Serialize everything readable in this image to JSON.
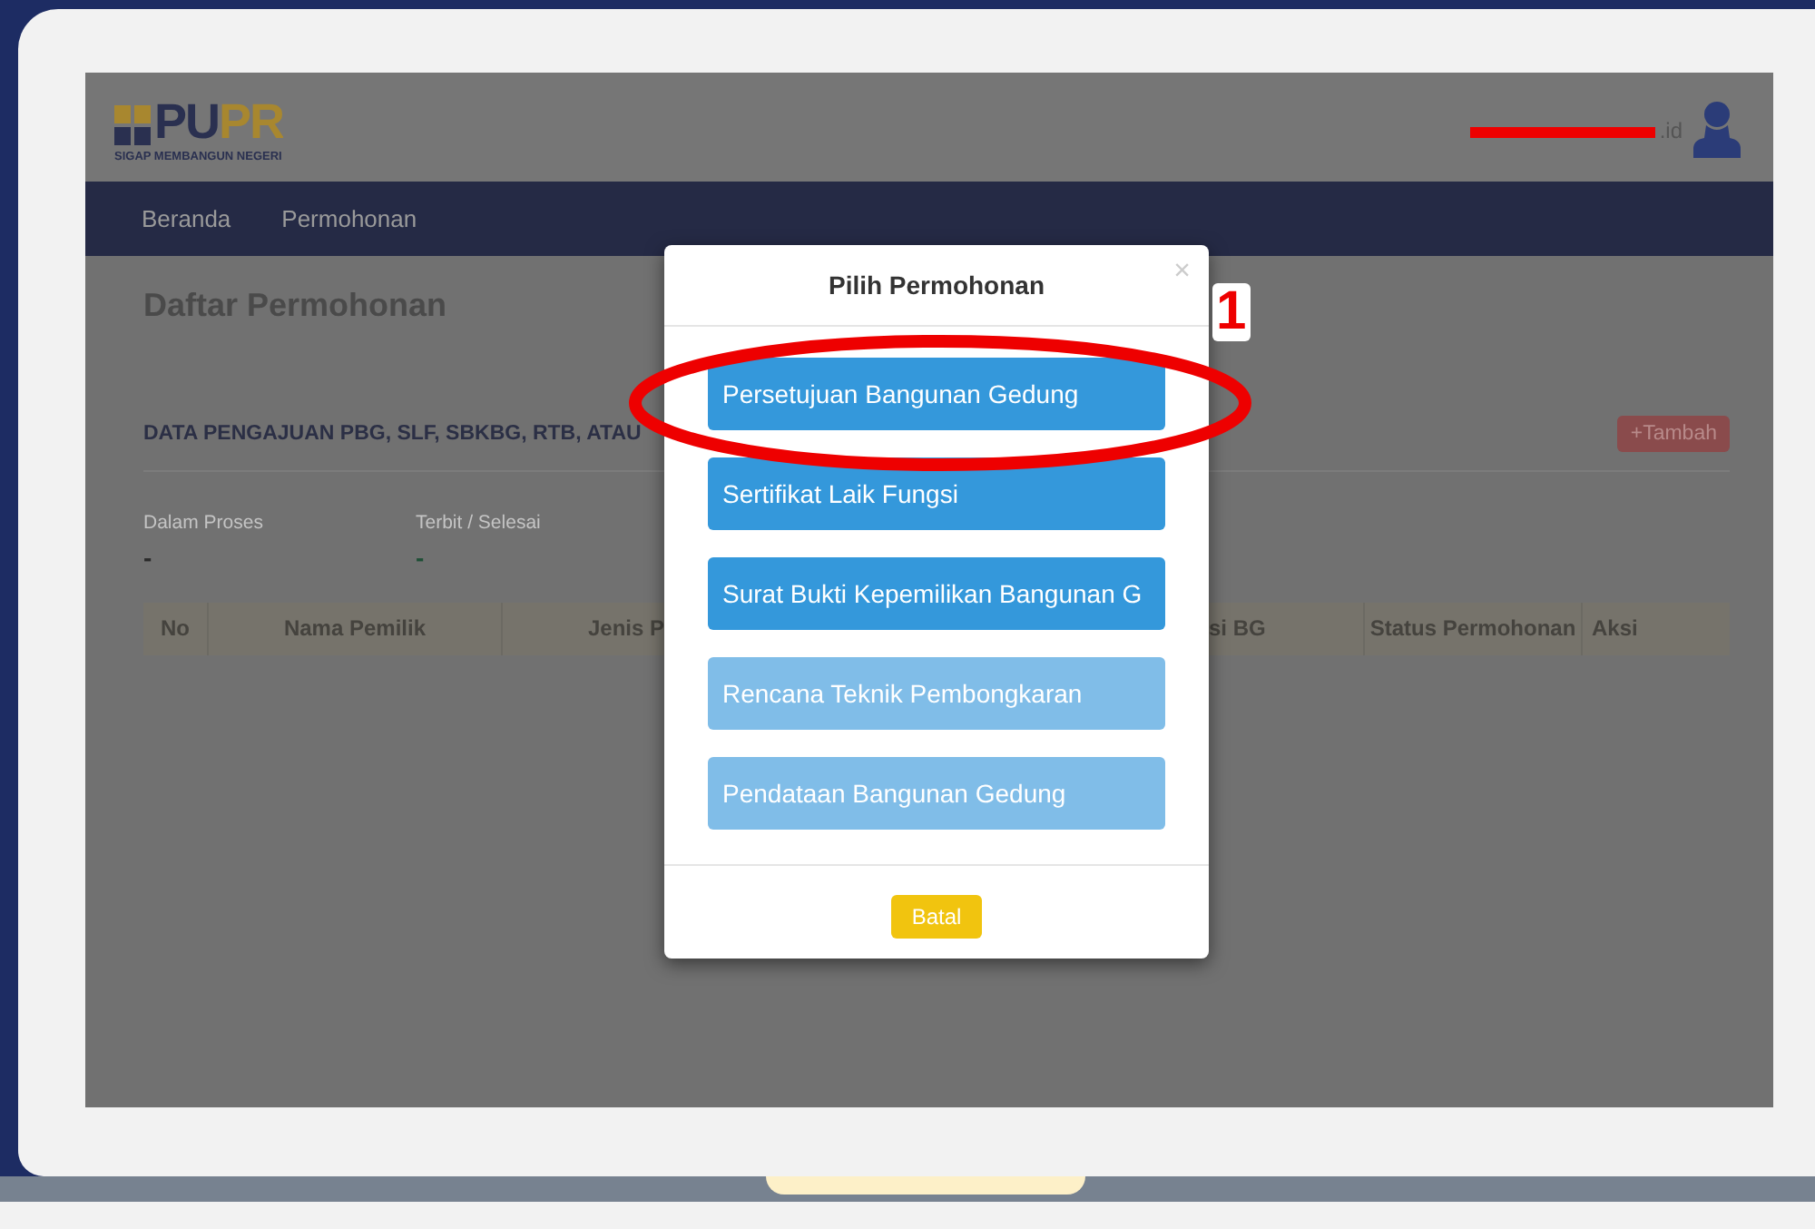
{
  "header": {
    "logo_text": "PUPR",
    "logo_tagline": "SIGAP MEMBANGUN NEGERI",
    "user_email": ".id"
  },
  "nav": {
    "items": [
      {
        "label": "Beranda"
      },
      {
        "label": "Permohonan"
      }
    ]
  },
  "page": {
    "title": "Daftar Permohonan",
    "panel_title": "DATA PENGAJUAN PBG, SLF, SBKBG, RTB, ATAU",
    "add_button": "+Tambah",
    "stats": [
      {
        "label": "Dalam Proses",
        "value": "-",
        "kind": "plain"
      },
      {
        "label": "Terbit / Selesai",
        "value": "-",
        "kind": "done"
      }
    ],
    "table": {
      "columns": [
        "No",
        "Nama Pemilik",
        "Jenis P",
        "si BG",
        "Status Permohonan",
        "Aksi"
      ]
    }
  },
  "modal": {
    "title": "Pilih Permohonan",
    "close": "×",
    "options": [
      {
        "label": "Persetujuan Bangunan Gedung",
        "disabled": false
      },
      {
        "label": "Sertifikat Laik Fungsi",
        "disabled": false
      },
      {
        "label": "Surat Bukti Kepemilikan Bangunan G",
        "disabled": false
      },
      {
        "label": "Rencana Teknik Pembongkaran",
        "disabled": true
      },
      {
        "label": "Pendataan Bangunan Gedung",
        "disabled": true
      }
    ],
    "cancel": "Batal"
  },
  "annotation": {
    "number": "1"
  }
}
